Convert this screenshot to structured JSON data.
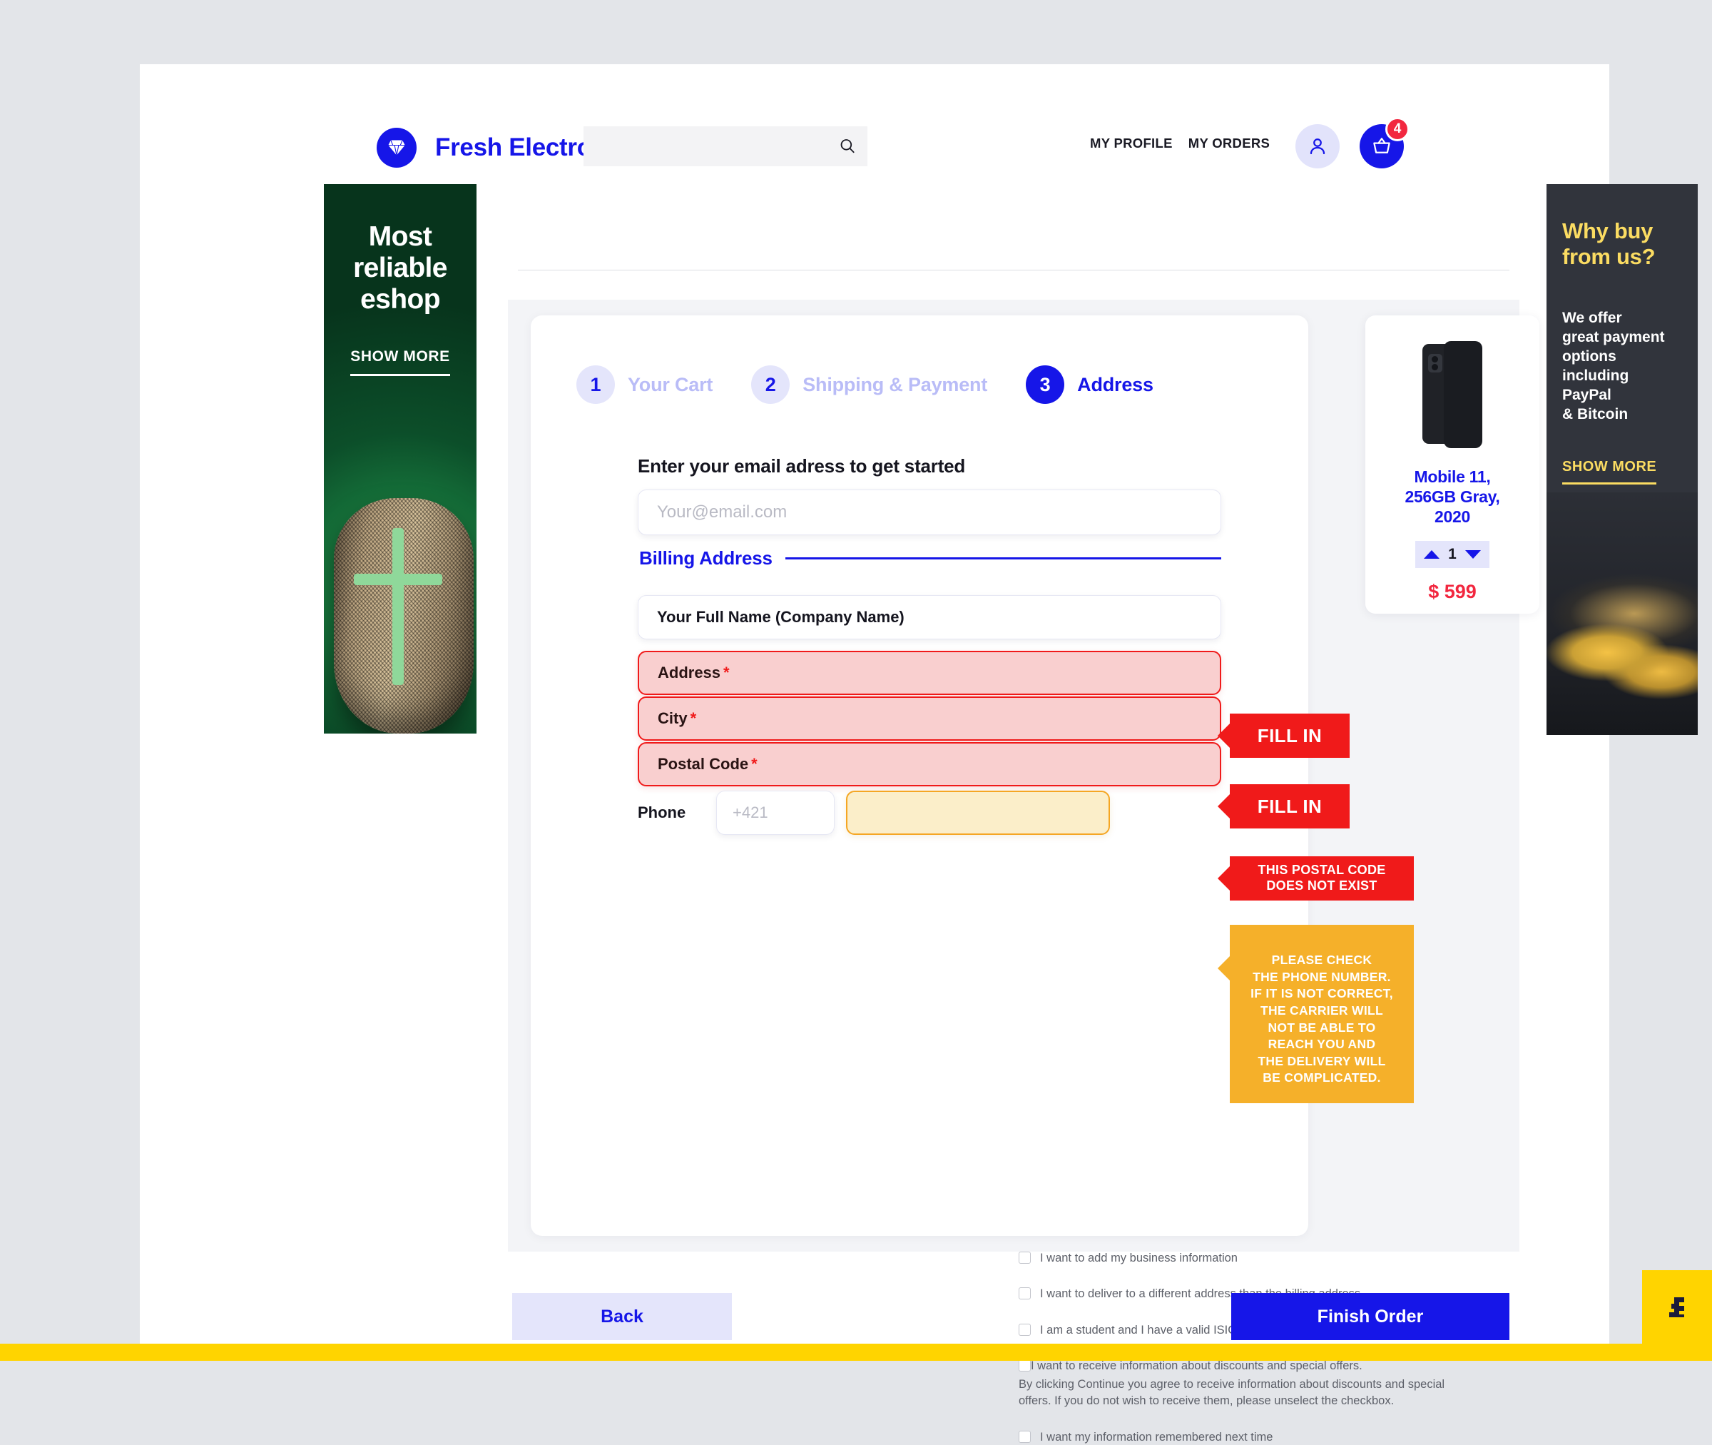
{
  "header": {
    "brand": "Fresh Electronics",
    "logo_icon": "diamond-icon",
    "search_placeholder": "",
    "search_value": "",
    "search_icon": "search-icon",
    "nav": [
      {
        "label": "MY PROFILE"
      },
      {
        "label": "MY ORDERS"
      }
    ],
    "avatar_icon": "user-icon",
    "cart_icon": "basket-icon",
    "cart_count": "4"
  },
  "banner_left": {
    "title": "Most\nreliable\neshop",
    "cta": "SHOW MORE",
    "bg_color": "#0b4a2a"
  },
  "banner_right": {
    "title": "Why buy\nfrom us?",
    "body": "We offer\ngreat payment\noptions\nincluding\nPayPal\n& Bitcoin",
    "cta": "SHOW MORE",
    "bg_color": "#31343c",
    "accent_color": "#fbdc62"
  },
  "steps": [
    {
      "number": "1",
      "label": "Your Cart",
      "active": false
    },
    {
      "number": "2",
      "label": "Shipping & Payment",
      "active": false
    },
    {
      "number": "3",
      "label": "Address",
      "active": true
    }
  ],
  "form": {
    "heading": "Enter your email adress to get started",
    "email_placeholder": "Your@email.com",
    "email_value": "",
    "section_title": "Billing Address",
    "name_value": "Your Full Name (Company Name)",
    "address_label": "Address",
    "city_label": "City",
    "postal_label": "Postal Code",
    "required_mark": "*",
    "phone_label": "Phone",
    "phone_code_placeholder": "+421",
    "phone_code_value": "",
    "phone_number_value": ""
  },
  "callouts": {
    "address": "FILL IN",
    "city": "FILL IN",
    "postal": "THIS POSTAL CODE\nDOES NOT EXIST",
    "phone": "PLEASE CHECK\nTHE PHONE NUMBER.\nIF IT IS NOT CORRECT,\nTHE CARRIER WILL\nNOT BE ABLE TO\nREACH YOU AND\nTHE DELIVERY WILL\nBE COMPLICATED.",
    "error_color": "#f01a1a",
    "warning_color": "#f5b02a"
  },
  "checkboxes": [
    {
      "label": "I want to add my business information",
      "checked": false
    },
    {
      "label": "I want to deliver to a different address than the billing address",
      "checked": false
    },
    {
      "label": "I am a student and I have a valid ISIC card.",
      "checked": false
    },
    {
      "label": "I want to receive information about discounts and special offers.",
      "checked": false,
      "note": "By clicking Continue you agree to receive information about discounts and special offers. If you do not wish to receive them, please unselect the checkbox."
    },
    {
      "label": "I want my information remembered next time",
      "checked": false
    }
  ],
  "product": {
    "title": "Mobile 11,\n256GB Gray,\n2020",
    "quantity": "1",
    "price": "$ 599",
    "price_color": "#f2273f"
  },
  "footer": {
    "back_label": "Back",
    "finish_label": "Finish Order"
  },
  "brand_colors": {
    "primary": "#1616e8",
    "page_bg": "#e3e5e9",
    "accent_yellow": "#ffd400"
  }
}
